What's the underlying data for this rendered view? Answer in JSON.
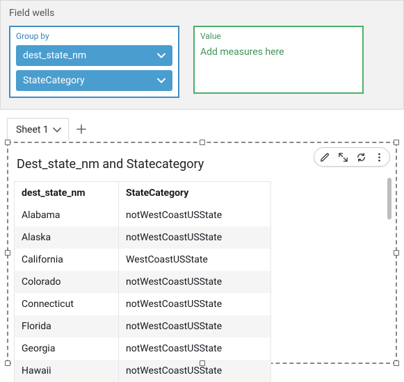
{
  "field_wells": {
    "section_title": "Field wells",
    "group_by": {
      "label": "Group by",
      "fields": [
        "dest_state_nm",
        "StateCategory"
      ]
    },
    "value": {
      "label": "Value",
      "placeholder": "Add measures here"
    }
  },
  "tabs": {
    "sheets": [
      "Sheet 1"
    ]
  },
  "visual": {
    "title": "Dest_state_nm and Statecategory",
    "columns": [
      "dest_state_nm",
      "StateCategory"
    ]
  },
  "chart_data": {
    "type": "table",
    "columns": [
      "dest_state_nm",
      "StateCategory"
    ],
    "rows": [
      [
        "Alabama",
        "notWestCoastUSState"
      ],
      [
        "Alaska",
        "notWestCoastUSState"
      ],
      [
        "California",
        "WestCoastUSState"
      ],
      [
        "Colorado",
        "notWestCoastUSState"
      ],
      [
        "Connecticut",
        "notWestCoastUSState"
      ],
      [
        "Florida",
        "notWestCoastUSState"
      ],
      [
        "Georgia",
        "notWestCoastUSState"
      ],
      [
        "Hawaii",
        "notWestCoastUSState"
      ]
    ]
  }
}
